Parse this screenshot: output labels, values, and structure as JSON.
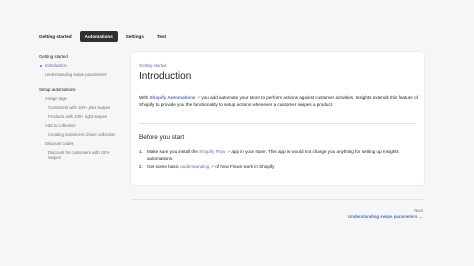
{
  "tabs": [
    {
      "label": "Getting started"
    },
    {
      "label": "Automations"
    },
    {
      "label": "Settings"
    },
    {
      "label": "Test"
    }
  ],
  "sidebar": {
    "sections": [
      {
        "heading": "Getting started",
        "items": [
          "Introduction",
          "Understanding swipe parameters"
        ]
      },
      {
        "heading": "Setup automations",
        "items": [
          "Assign tags",
          "Customers with 100+ plus swipes",
          "Products with 100+ right swipes",
          "Add to collection",
          "Creating customers chiore collection",
          "Discount codes",
          "Discount for customers with 100+ swipes"
        ]
      }
    ]
  },
  "main": {
    "breadcrumb": "Getting started",
    "title": "Introduction",
    "intro_prefix": "With",
    "intro_link": "Shopify Automations",
    "intro_rest": "you add automate your store to perform actions against customer activities. Insights extends this feature of Shopify to provide you the functionality to setup actions whenever a customer swipes a product.",
    "section_title": "Before you start",
    "step1_num": "1.",
    "step1_prefix": "Make sure you install the",
    "step1_link": "Shopify Flow",
    "step1_rest": "app in your store. This app is would not charge you anything for setting up Insights automations.",
    "step2_num": "2.",
    "step2_prefix": "Get some basic",
    "step2_link": "understanding",
    "step2_rest": "of how Flows work in Shopify"
  },
  "footer": {
    "next_label": "Next",
    "next_link": "Understanding swipe parameters →"
  },
  "colors": {
    "accent": "#5c6ac4",
    "active_tab": "#303030",
    "background": "#f6f6f7"
  }
}
